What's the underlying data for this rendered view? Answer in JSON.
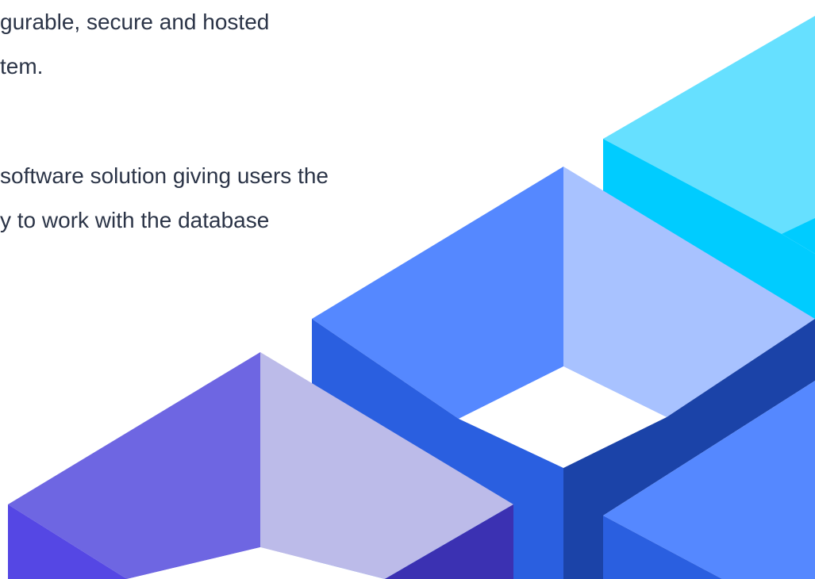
{
  "text": {
    "paragraph_1": {
      "line_1": "gurable, secure and hosted",
      "line_2": "tem."
    },
    "paragraph_2": {
      "line_1": "software solution giving users the",
      "line_2": "y to work with the database"
    }
  },
  "colors": {
    "text": "#2b3447",
    "background": "#ffffff",
    "cyan_light": "#66e0ff",
    "cyan": "#00ccff",
    "blue_top": "#5588ff",
    "blue_light": "#a8c2ff",
    "blue_mid": "#2a5fe0",
    "blue_dark": "#1b43a8",
    "purple_top": "#6e66e2",
    "purple_light": "#bcbbe9",
    "purple_mid": "#5547e4",
    "purple_dark": "#3b31b2"
  },
  "decoration": {
    "name": "isometric-cubes-illustration"
  }
}
